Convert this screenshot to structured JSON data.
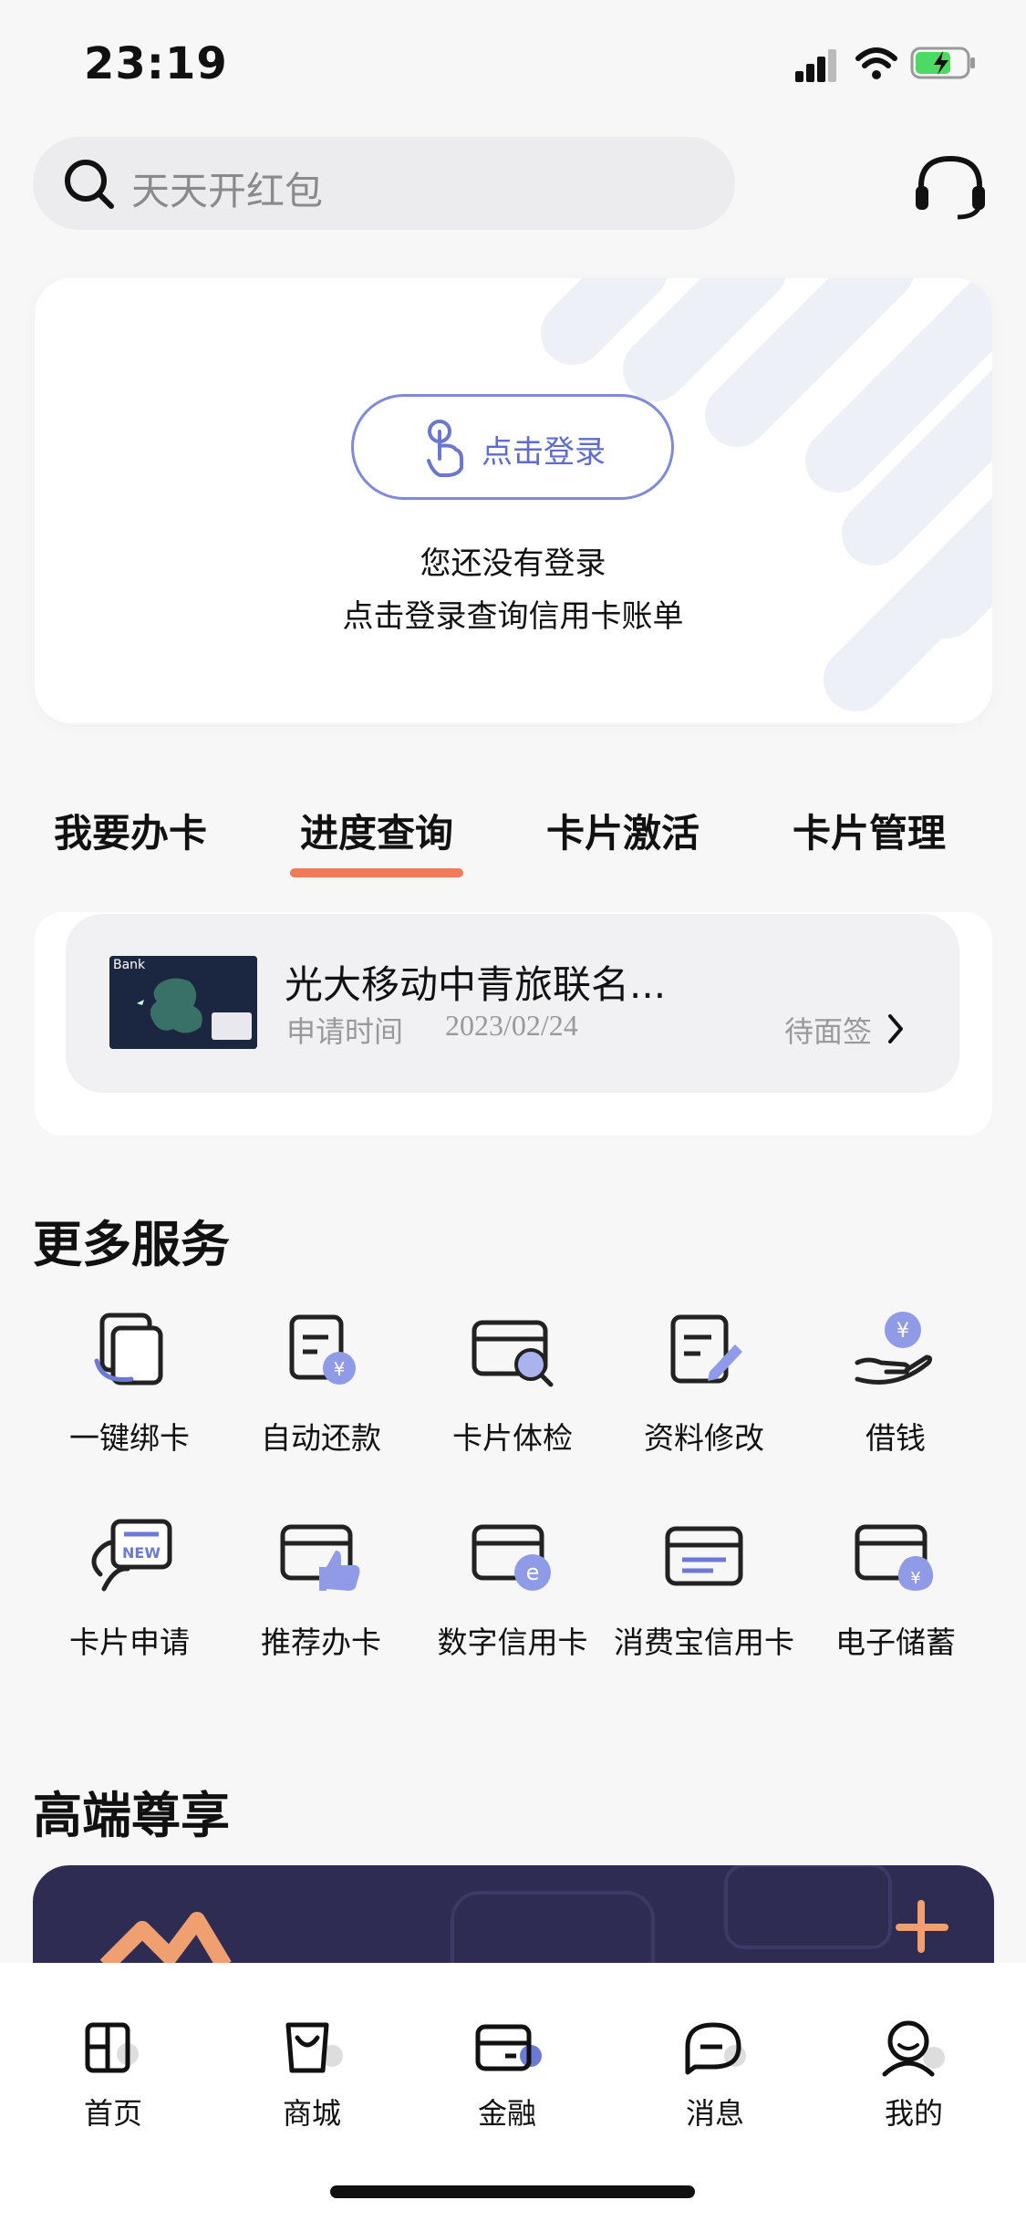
{
  "status_bar": {
    "time": "23:19"
  },
  "search": {
    "placeholder": "天天开红包",
    "icon": "search-icon"
  },
  "header": {
    "support_icon": "headset-icon"
  },
  "login_card": {
    "button_label": "点击登录",
    "line1": "您还没有登录",
    "line2": "点击登录查询信用卡账单"
  },
  "tabs": [
    {
      "label": "我要办卡",
      "active": false
    },
    {
      "label": "进度查询",
      "active": true
    },
    {
      "label": "卡片激活",
      "active": false
    },
    {
      "label": "卡片管理",
      "active": false
    }
  ],
  "progress": {
    "card_name": "光大移动中青旅联名...",
    "time_label": "申请时间",
    "date": "2023/02/24",
    "status": "待面签",
    "thumb_text": "Bank"
  },
  "more_services": {
    "title": "更多服务",
    "items": [
      {
        "label": "一键绑卡",
        "icon": "bind-card-icon"
      },
      {
        "label": "自动还款",
        "icon": "auto-repay-icon"
      },
      {
        "label": "卡片体检",
        "icon": "card-check-icon"
      },
      {
        "label": "资料修改",
        "icon": "edit-info-icon"
      },
      {
        "label": "借钱",
        "icon": "borrow-icon"
      },
      {
        "label": "卡片申请",
        "icon": "card-apply-icon"
      },
      {
        "label": "推荐办卡",
        "icon": "recommend-card-icon"
      },
      {
        "label": "数字信用卡",
        "icon": "digital-card-icon"
      },
      {
        "label": "消费宝信用卡",
        "icon": "xiaofeibao-card-icon"
      },
      {
        "label": "电子储蓄",
        "icon": "e-savings-icon"
      }
    ]
  },
  "premium": {
    "title": "高端尊享"
  },
  "bottom_nav": [
    {
      "label": "首页",
      "icon": "home-icon"
    },
    {
      "label": "商城",
      "icon": "mall-icon"
    },
    {
      "label": "金融",
      "icon": "finance-icon",
      "active": true
    },
    {
      "label": "消息",
      "icon": "message-icon"
    },
    {
      "label": "我的",
      "icon": "profile-icon"
    }
  ],
  "colors": {
    "accent": "#7f8ad8",
    "tab_indicator": "#f07a5a",
    "banner": "#2e2c52"
  }
}
